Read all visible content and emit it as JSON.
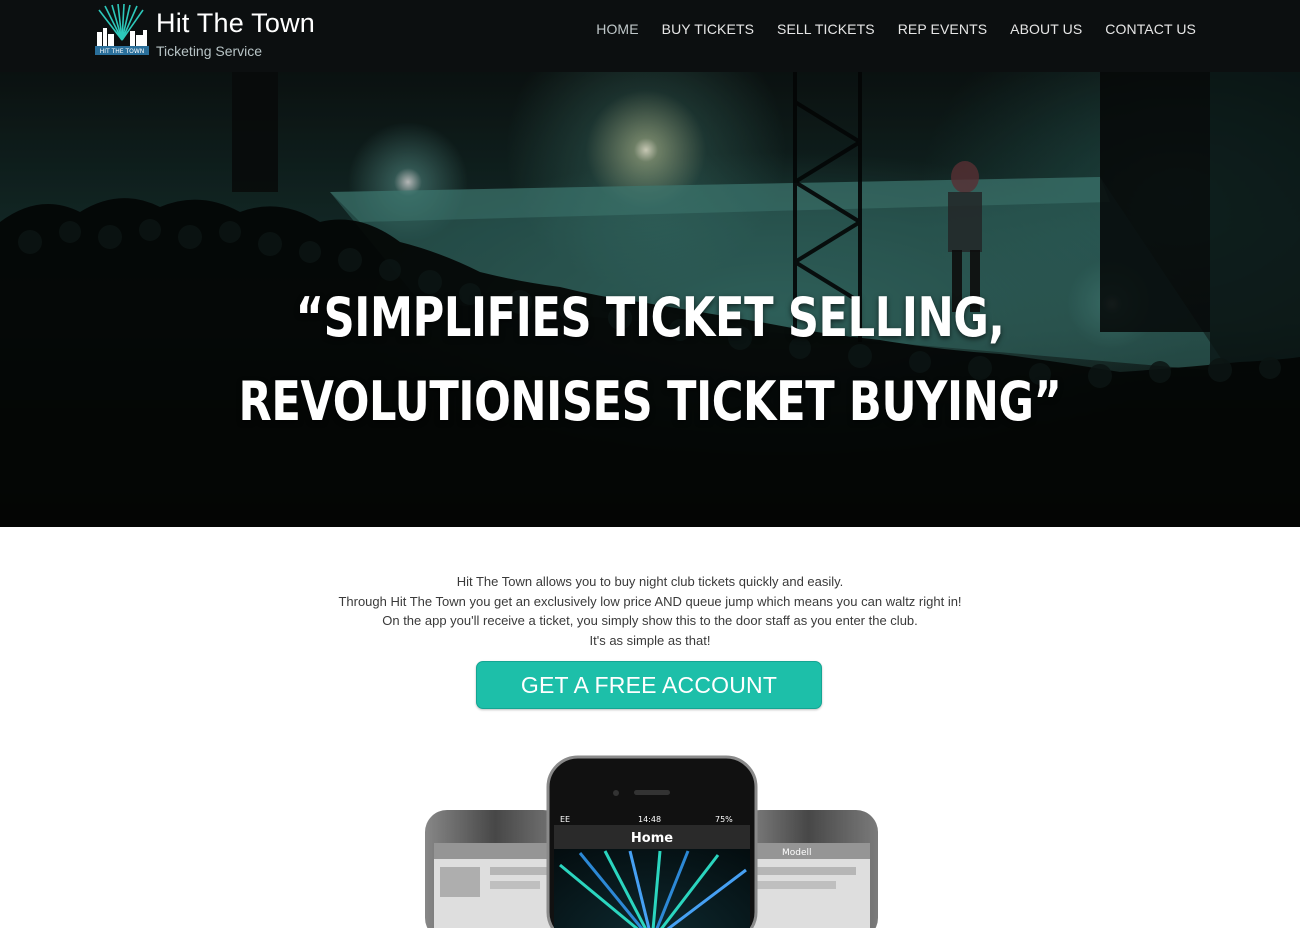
{
  "brand": {
    "logo_name": "hit-the-town-logo",
    "logo_text": "HIT THE TOWN",
    "title": "Hit The Town",
    "subtitle": "Ticketing Service"
  },
  "nav": [
    {
      "label": "HOME",
      "active": true
    },
    {
      "label": "BUY TICKETS",
      "active": false
    },
    {
      "label": "SELL TICKETS",
      "active": false
    },
    {
      "label": "REP EVENTS",
      "active": false
    },
    {
      "label": "ABOUT US",
      "active": false
    },
    {
      "label": "CONTACT US",
      "active": false
    }
  ],
  "hero": {
    "quote_line1": "“SIMPLIFIES TICKET SELLING,",
    "quote_line2": "REVOLUTIONISES TICKET BUYING”",
    "image": "concert-crowd-photo"
  },
  "intro": {
    "lines": [
      "Hit The Town allows you to buy night club tickets quickly and easily.",
      "Through Hit The Town you get an exclusively low price AND queue jump which means you can waltz right in!",
      "On the app you'll receive a ticket, you simply show this to the door staff as you enter the club.",
      "It's as simple as that!"
    ]
  },
  "cta": {
    "label": "GET A FREE ACCOUNT"
  },
  "phone": {
    "carrier": "EE",
    "time": "14:48",
    "battery": "75%",
    "screen_title": "Home",
    "side_tab": "Modell"
  },
  "colors": {
    "header_bg": "#0c0f10",
    "accent": "#1dbfa9",
    "text": "#3a3a3a"
  }
}
